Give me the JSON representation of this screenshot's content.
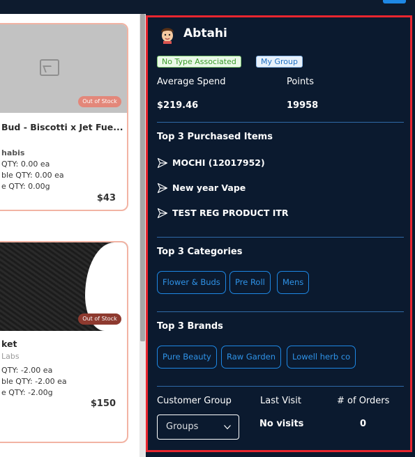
{
  "products": [
    {
      "name": "Bud - Biscotti x Jet Fue...",
      "category": "habis",
      "stock_badge": "Out of Stock",
      "qty_lines": [
        "QTY: 0.00 ea",
        "ble QTY: 0.00 ea",
        "e QTY: 0.00g"
      ],
      "price": "$43"
    },
    {
      "name": "ket",
      "category": "Labs",
      "stock_badge": "Out of Stock",
      "qty_lines": [
        "QTY: -2.00 ea",
        "ble QTY: -2.00 ea",
        "e QTY: -2.00g"
      ],
      "price": "$150"
    }
  ],
  "customer": {
    "name": "Abtahi",
    "avatar_icon": "person-avatar-icon",
    "type_tag": "No Type Associated",
    "group_tag": "My Group"
  },
  "stats": {
    "average_spend_label": "Average Spend",
    "average_spend_value": "$219.46",
    "points_label": "Points",
    "points_value": "19958"
  },
  "top_items": {
    "title": "Top 3 Purchased Items",
    "icon": "send-arrow-icon",
    "items": [
      "MOCHI (12017952)",
      "New year Vape",
      "TEST REG PRODUCT ITR"
    ]
  },
  "top_categories": {
    "title": "Top 3 Categories",
    "items": [
      "Flower & Buds",
      "Pre Roll",
      "Mens"
    ]
  },
  "top_brands": {
    "title": "Top 3 Brands",
    "items": [
      "Pure Beauty",
      "Raw Garden",
      "Lowell herb co"
    ]
  },
  "footer": {
    "customer_group_label": "Customer Group",
    "group_select_value": "Groups",
    "last_visit_label": "Last Visit",
    "last_visit_value": "No visits",
    "orders_label": "# of Orders",
    "orders_value": "0"
  },
  "colors": {
    "panel_bg": "#0b1a2f",
    "accent_blue": "#1e88e5",
    "highlight_red": "#e8262f",
    "card_border": "#f2b3a3"
  }
}
